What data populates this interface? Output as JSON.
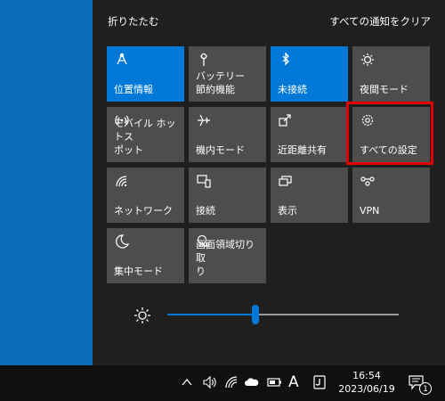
{
  "action_center": {
    "collapse_label": "折りたたむ",
    "clear_all_label": "すべての通知をクリア",
    "tiles": [
      {
        "label": "位置情報",
        "icon": "location-icon",
        "active": true
      },
      {
        "label": "バッテリー\n節約機能",
        "icon": "battery-saver-icon",
        "active": false
      },
      {
        "label": "未接続",
        "icon": "bluetooth-icon",
        "active": true
      },
      {
        "label": "夜間モード",
        "icon": "night-light-icon",
        "active": false
      },
      {
        "label": "モバイル ホットス\nポット",
        "icon": "mobile-hotspot-icon",
        "active": false
      },
      {
        "label": "機内モード",
        "icon": "airplane-icon",
        "active": false
      },
      {
        "label": "近距離共有",
        "icon": "nearby-share-icon",
        "active": false
      },
      {
        "label": "すべての設定",
        "icon": "settings-gear-icon",
        "active": false
      },
      {
        "label": "ネットワーク",
        "icon": "network-icon",
        "active": false
      },
      {
        "label": "接続",
        "icon": "connect-icon",
        "active": false
      },
      {
        "label": "表示",
        "icon": "project-icon",
        "active": false
      },
      {
        "label": "VPN",
        "icon": "vpn-icon",
        "active": false
      },
      {
        "label": "集中モード",
        "icon": "focus-assist-icon",
        "active": false
      },
      {
        "label": "画面領域切り取\nり",
        "icon": "screen-snip-icon",
        "active": false
      }
    ],
    "brightness_percent": 38
  },
  "taskbar": {
    "ime_label": "A",
    "time": "16:54",
    "date": "2023/06/19",
    "notification_count": "1"
  },
  "colors": {
    "accent": "#0078d7",
    "tile": "#4d4d4d",
    "highlight": "#e00000",
    "desktop": "#0a6ebd"
  }
}
